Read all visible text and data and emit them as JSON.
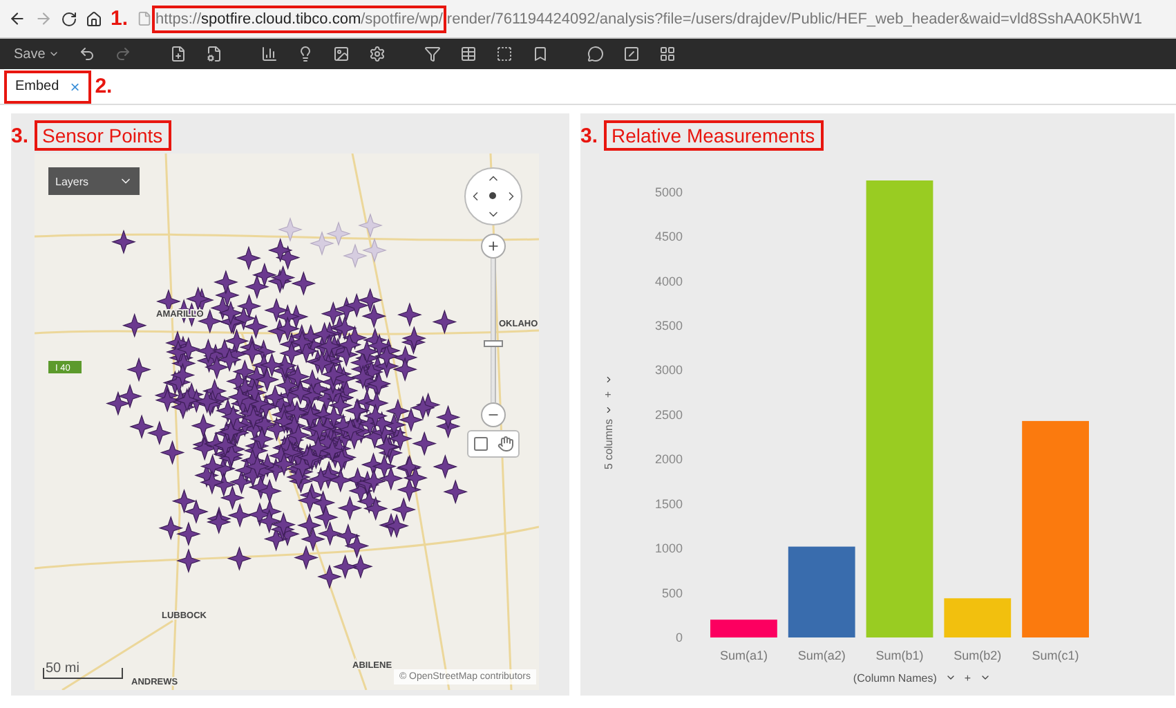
{
  "browser": {
    "url_parts": [
      {
        "text": "https://",
        "emphasis": false,
        "boxed": true
      },
      {
        "text": "spotfire.cloud.tibco.com",
        "emphasis": true,
        "boxed": true
      },
      {
        "text": "/spotfire/wp/",
        "emphasis": false,
        "boxed": true
      },
      {
        "text": "render/761194424092/analysis?file=/users/drajdev/Public/HEF_web_header&waid=vld8SshAA0K5hW1",
        "emphasis": false,
        "boxed": false
      }
    ],
    "callout": "1."
  },
  "toolbar": {
    "save": "Save",
    "redo_disabled": true
  },
  "tabs": [
    {
      "label": "Embed",
      "selected": true,
      "close": "×"
    }
  ],
  "tabs_callout": "2.",
  "panels": [
    {
      "kind": "map",
      "callout": "3.",
      "title": "Sensor Points",
      "layers": "Layers",
      "zoom": {
        "level": 0.4
      },
      "labels": [
        {
          "kind": "highway",
          "text": "I 40"
        },
        {
          "kind": "city",
          "text": "AMARILLO"
        },
        {
          "kind": "city",
          "text": "OKLAHO"
        },
        {
          "kind": "city",
          "text": "LUBBOCK"
        },
        {
          "kind": "city",
          "text": "ABILENE"
        },
        {
          "kind": "city",
          "text": "ANDREWS"
        }
      ],
      "scale": "50 mi",
      "attribution": "© OpenStreetMap contributors"
    },
    {
      "kind": "bar_chart",
      "callout": "3.",
      "title": "Relative Measurements",
      "y_selector": {
        "plus": "+"
      },
      "x_selector": {
        "plus": "+"
      },
      "chart_data": {
        "type": "bar",
        "categories": [
          "Sum(a1)",
          "Sum(a2)",
          "Sum(b1)",
          "Sum(b2)",
          "Sum(c1)"
        ],
        "values": [
          200,
          1020,
          5130,
          440,
          2430
        ],
        "colors": [
          "#fc0060",
          "#396cad",
          "#99cc22",
          "#f2c00e",
          "#fb7a0e"
        ],
        "ylabel": "5 columns",
        "xlabel": "(Column Names)",
        "ylim": [
          0,
          5200
        ],
        "yticks": [
          0,
          500,
          1000,
          1500,
          2000,
          2500,
          3000,
          3500,
          4000,
          4500,
          5000
        ]
      }
    }
  ]
}
